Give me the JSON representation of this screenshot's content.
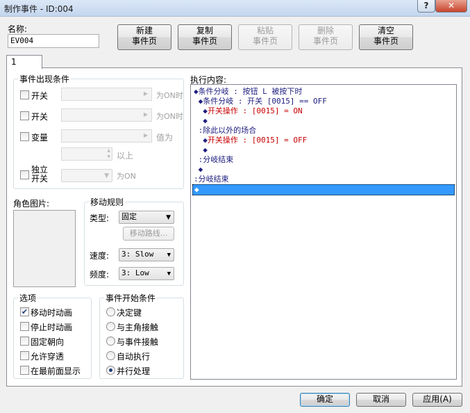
{
  "window": {
    "title": "制作事件 - ID:004"
  },
  "name_field": {
    "label": "名称:",
    "value": "EV004"
  },
  "page_buttons": [
    {
      "line1": "新建",
      "line2": "事件页",
      "enabled": true
    },
    {
      "line1": "复制",
      "line2": "事件页",
      "enabled": true
    },
    {
      "line1": "粘贴",
      "line2": "事件页",
      "enabled": false
    },
    {
      "line1": "删除",
      "line2": "事件页",
      "enabled": false
    },
    {
      "line1": "清空",
      "line2": "事件页",
      "enabled": true
    }
  ],
  "tabs": [
    "1"
  ],
  "conditions": {
    "title": "事件出现条件",
    "switch1": {
      "label": "开关",
      "suffix": "为ON时"
    },
    "switch2": {
      "label": "开关",
      "suffix": "为ON时"
    },
    "variable": {
      "label": "变量",
      "suffix": "值为",
      "above": "以上"
    },
    "self_switch": {
      "label_line1": "独立",
      "label_line2": "开关",
      "suffix": "为ON"
    }
  },
  "graphic": {
    "title": "角色图片:"
  },
  "movement": {
    "title": "移动规则",
    "type_label": "类型:",
    "type_value": "固定",
    "route_button": "移动路线...",
    "speed_label": "速度:",
    "speed_value": "3: Slow",
    "freq_label": "频度:",
    "freq_value": "3: Low"
  },
  "options": {
    "title": "选项",
    "items": [
      {
        "label": "移动时动画",
        "checked": true
      },
      {
        "label": "停止时动画",
        "checked": false
      },
      {
        "label": "固定朝向",
        "checked": false
      },
      {
        "label": "允许穿透",
        "checked": false
      },
      {
        "label": "在最前面显示",
        "checked": false
      }
    ]
  },
  "trigger": {
    "title": "事件开始条件",
    "items": [
      {
        "label": "决定键",
        "selected": false
      },
      {
        "label": "与主角接触",
        "selected": false
      },
      {
        "label": "与事件接触",
        "selected": false
      },
      {
        "label": "自动执行",
        "selected": false
      },
      {
        "label": "并行处理",
        "selected": true
      }
    ]
  },
  "contents": {
    "title": "执行内容:",
    "lines": [
      {
        "marker": "◆",
        "text": "条件分岐 : 按钮 L 被按下时",
        "red": false
      },
      {
        "marker": " ◆",
        "text": "条件分岐 : 开关 [0015] == OFF",
        "red": false
      },
      {
        "marker": "  ◆",
        "text": "开关操作 : [0015] = ON",
        "red": true
      },
      {
        "marker": "  ◆",
        "text": "",
        "red": false
      },
      {
        "marker": " :",
        "text": "除此以外的场合",
        "red": false
      },
      {
        "marker": "  ◆",
        "text": "开关操作 : [0015] = OFF",
        "red": true
      },
      {
        "marker": "  ◆",
        "text": "",
        "red": false
      },
      {
        "marker": " :",
        "text": "分岐结束",
        "red": false
      },
      {
        "marker": " ◆",
        "text": "",
        "red": false
      },
      {
        "marker": ":",
        "text": "分岐结束",
        "red": false
      },
      {
        "marker": "◆",
        "text": "",
        "red": false,
        "selected": true
      }
    ]
  },
  "footer": {
    "ok": "确定",
    "cancel": "取消",
    "apply": "应用(A)"
  },
  "colors": {
    "selection": "#3399ff",
    "red_text": "#c80000",
    "text_blue": "#202080"
  },
  "icons": {
    "help": "?",
    "close": "✕",
    "dropdown": "▼",
    "spin_up": "▲",
    "spin_down": "▼",
    "right_arrow": "▶",
    "check": "✔"
  }
}
